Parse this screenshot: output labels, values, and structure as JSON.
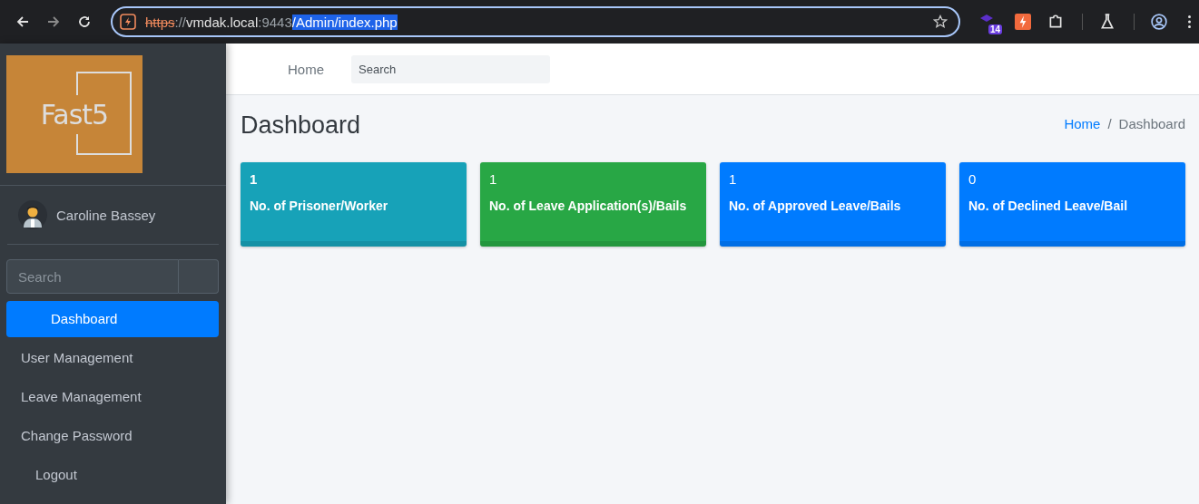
{
  "browser": {
    "url": {
      "scheme": "https",
      "separator": "://",
      "host": "vmdak.local",
      "port": ":9443",
      "path": "/Admin/index.php",
      "path_selected": true
    },
    "extension_badge": "14"
  },
  "sidebar": {
    "logo": "Fast5",
    "user": "Caroline Bassey",
    "search": {
      "placeholder": "Search"
    },
    "items": [
      {
        "label": "Dashboard",
        "selected": true,
        "indent": true
      },
      {
        "label": "User Management",
        "selected": false,
        "indent": false
      },
      {
        "label": "Leave Management",
        "selected": false,
        "indent": false
      },
      {
        "label": "Change Password",
        "selected": false,
        "indent": false
      },
      {
        "label": "Logout",
        "selected": false,
        "indent": true
      }
    ]
  },
  "topbar": {
    "home": "Home",
    "search": {
      "placeholder": "Search"
    }
  },
  "page": {
    "title": "Dashboard",
    "breadcrumb": [
      {
        "label": "Home",
        "kind": "link"
      },
      {
        "label": "/",
        "kind": "separator"
      },
      {
        "label": "Dashboard",
        "kind": "current"
      }
    ]
  },
  "cards": [
    {
      "value": "1",
      "label": "No. of Prisoner/Worker",
      "color": "#17a2b8",
      "bold_value": true
    },
    {
      "value": "1",
      "label": "No. of Leave Application(s)/Bails",
      "color": "#28a745",
      "bold_value": false
    },
    {
      "value": "1",
      "label": "No. of Approved Leave/Bails",
      "color": "#007bff",
      "bold_value": false
    },
    {
      "value": "0",
      "label": "No. of Declined Leave/Bail",
      "color": "#007bff",
      "bold_value": false
    }
  ]
}
